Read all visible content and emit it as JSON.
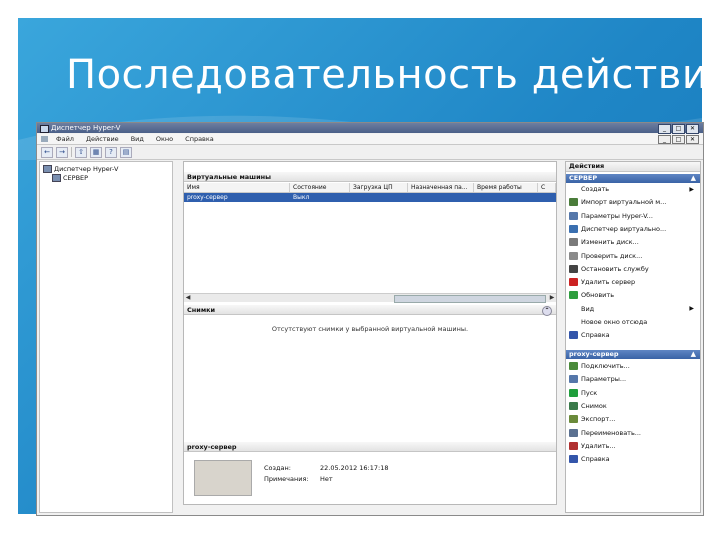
{
  "slide": {
    "title": "Последовательность действий"
  },
  "window": {
    "title": "Диспетчер Hyper-V",
    "controls": [
      "_",
      "□",
      "✕"
    ],
    "inner_controls": [
      "_",
      "□",
      "✕"
    ]
  },
  "menu": [
    "Файл",
    "Действие",
    "Вид",
    "Окно",
    "Справка"
  ],
  "toolbar": {
    "back": "←",
    "forward": "→",
    "up": "⇧",
    "show_tree": "▦",
    "help": "?",
    "props": "▤"
  },
  "tree": {
    "root": "Диспетчер Hyper-V",
    "server": "СЕРВЕР"
  },
  "vms": {
    "header": "Виртуальные машины",
    "columns": [
      "Имя",
      "Состояние",
      "Загрузка ЦП",
      "Назначенная па...",
      "Время работы",
      "С"
    ],
    "rows": [
      {
        "name": "proxy-сервер",
        "state": "Выкл",
        "cpu": "",
        "mem": "",
        "uptime": "",
        "s": ""
      }
    ]
  },
  "snapshots": {
    "header": "Снимки",
    "empty_text": "Отсутствуют снимки у выбранной виртуальной машины."
  },
  "details": {
    "header": "proxy-сервер",
    "created_label": "Создан:",
    "created_value": "22.05.2012 16:17:18",
    "notes_label": "Примечания:",
    "notes_value": "Нет"
  },
  "actions": {
    "header": "Действия",
    "group1": "СЕРВЕР",
    "group1_items": [
      {
        "label": "Создать",
        "icon": "none",
        "arrow": "▶"
      },
      {
        "label": "Импорт виртуальной м...",
        "icon": "import-icon",
        "color": "#4a7c3a"
      },
      {
        "label": "Параметры Hyper-V...",
        "icon": "settings-icon",
        "color": "#5577aa"
      },
      {
        "label": "Диспетчер виртуально...",
        "icon": "network-icon",
        "color": "#3a6fb0"
      },
      {
        "label": "Изменить диск...",
        "icon": "disk-edit-icon",
        "color": "#7a7a7a"
      },
      {
        "label": "Проверить диск...",
        "icon": "disk-check-icon",
        "color": "#8a8a8a"
      },
      {
        "label": "Остановить службу",
        "icon": "stop-icon",
        "color": "#444444"
      },
      {
        "label": "Удалить сервер",
        "icon": "delete-icon",
        "color": "#cc2222"
      },
      {
        "label": "Обновить",
        "icon": "refresh-icon",
        "color": "#2e9e3e"
      },
      {
        "label": "Вид",
        "icon": "none",
        "arrow": "▶"
      },
      {
        "label": "Новое окно отсюда",
        "icon": "none"
      },
      {
        "label": "Справка",
        "icon": "help-icon",
        "color": "#3355aa"
      }
    ],
    "group2": "proxy-сервер",
    "group2_items": [
      {
        "label": "Подключить...",
        "icon": "connect-icon",
        "color": "#4a8a3a"
      },
      {
        "label": "Параметры...",
        "icon": "settings-icon",
        "color": "#5577aa"
      },
      {
        "label": "Пуск",
        "icon": "start-icon",
        "color": "#1f9e3c"
      },
      {
        "label": "Снимок",
        "icon": "snapshot-icon",
        "color": "#3a7a4a"
      },
      {
        "label": "Экспорт...",
        "icon": "export-icon",
        "color": "#6a8a3a"
      },
      {
        "label": "Переименовать...",
        "icon": "rename-icon",
        "color": "#5a7090"
      },
      {
        "label": "Удалить...",
        "icon": "delete-icon",
        "color": "#b03030"
      },
      {
        "label": "Справка",
        "icon": "help-icon",
        "color": "#3355aa"
      }
    ]
  }
}
